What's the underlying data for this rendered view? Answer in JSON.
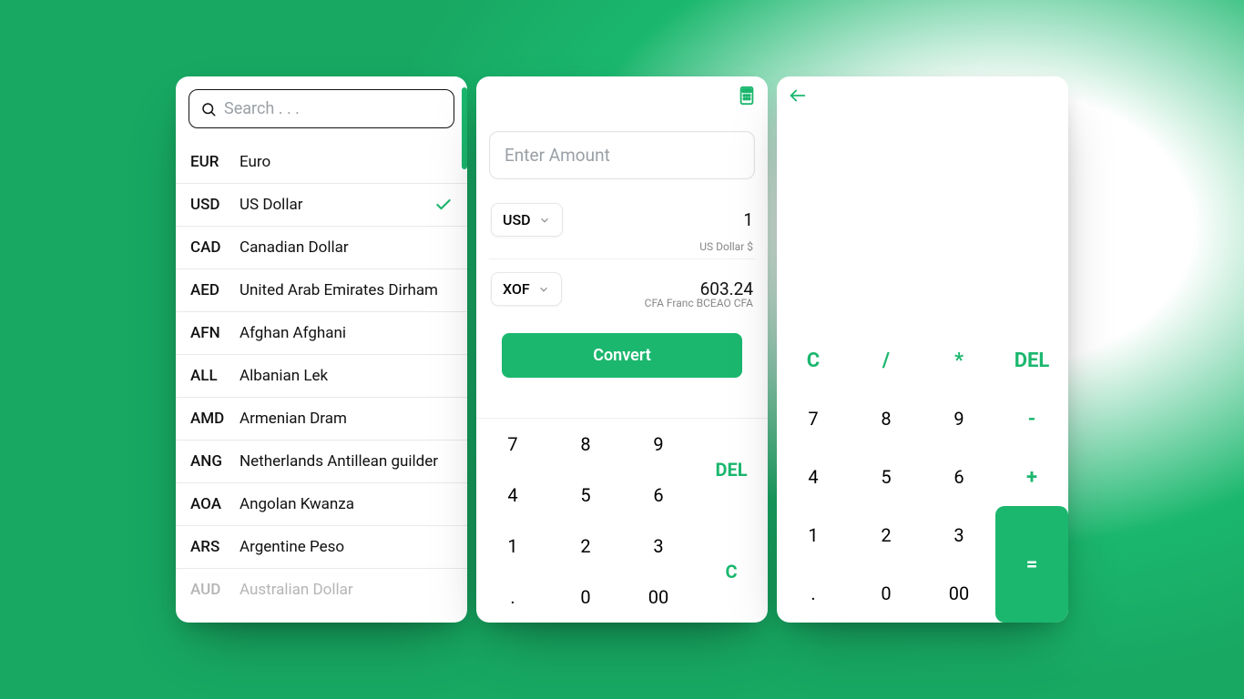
{
  "search": {
    "placeholder": "Search . . ."
  },
  "currencies": [
    {
      "code": "EUR",
      "name": "Euro",
      "selected": false
    },
    {
      "code": "USD",
      "name": "US Dollar",
      "selected": true
    },
    {
      "code": "CAD",
      "name": "Canadian Dollar",
      "selected": false
    },
    {
      "code": "AED",
      "name": "United Arab Emirates Dirham",
      "selected": false
    },
    {
      "code": "AFN",
      "name": "Afghan Afghani",
      "selected": false
    },
    {
      "code": "ALL",
      "name": "Albanian Lek",
      "selected": false
    },
    {
      "code": "AMD",
      "name": "Armenian Dram",
      "selected": false
    },
    {
      "code": "ANG",
      "name": "Netherlands Antillean guilder",
      "selected": false
    },
    {
      "code": "AOA",
      "name": "Angolan Kwanza",
      "selected": false
    },
    {
      "code": "ARS",
      "name": "Argentine Peso",
      "selected": false
    },
    {
      "code": "AUD",
      "name": "Australian Dollar",
      "selected": false,
      "faded": true
    }
  ],
  "converter": {
    "amount_placeholder": "Enter Amount",
    "from": {
      "code": "USD",
      "value": "1",
      "sub": "US Dollar $"
    },
    "to": {
      "code": "XOF",
      "value": "603.24",
      "sub": "CFA Franc BCEAO CFA"
    },
    "convert_label": "Convert",
    "numpad": {
      "k7": "7",
      "k8": "8",
      "k9": "9",
      "del": "DEL",
      "k4": "4",
      "k5": "5",
      "k6": "6",
      "k1": "1",
      "k2": "2",
      "k3": "3",
      "c": "C",
      "dot": ".",
      "k0": "0",
      "k00": "00"
    }
  },
  "calculator": {
    "pad": {
      "c": "C",
      "div": "/",
      "mul": "*",
      "del": "DEL",
      "k7": "7",
      "k8": "8",
      "k9": "9",
      "sub": "-",
      "k4": "4",
      "k5": "5",
      "k6": "6",
      "add": "+",
      "k1": "1",
      "k2": "2",
      "k3": "3",
      "eq": "=",
      "dot": ".",
      "k0": "0",
      "k00": "00"
    }
  },
  "colors": {
    "accent": "#1bb76e"
  }
}
